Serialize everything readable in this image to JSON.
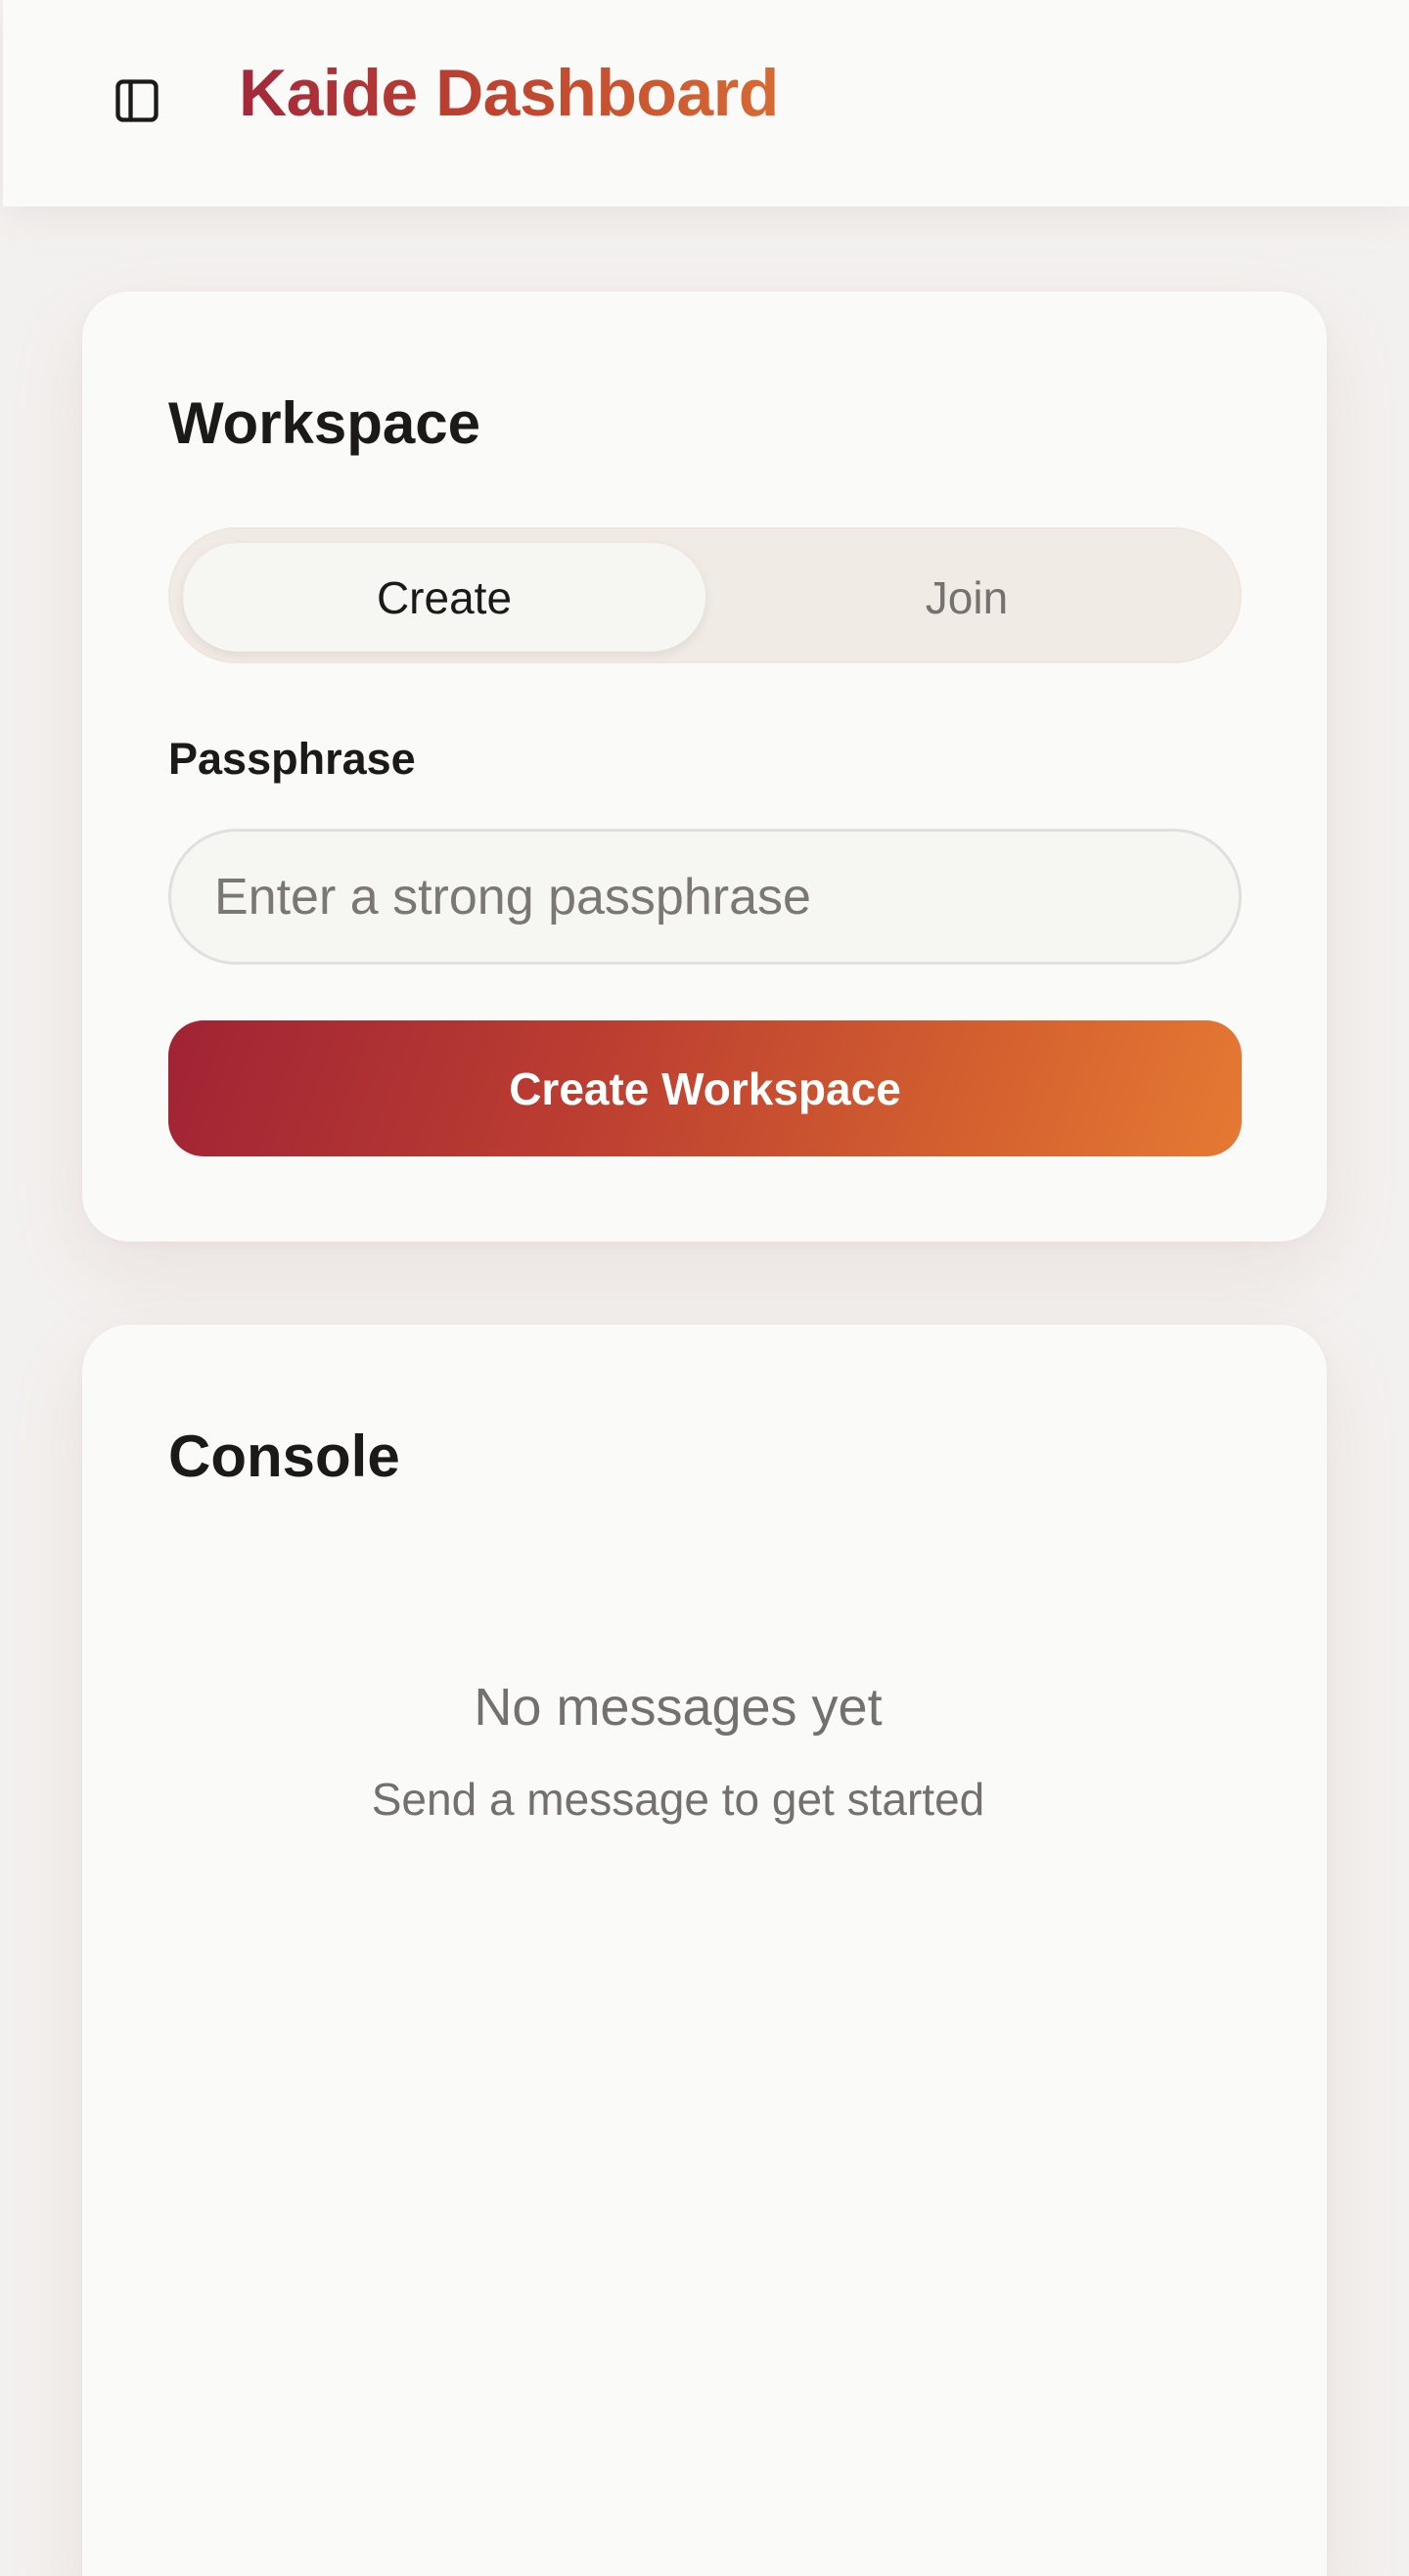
{
  "header": {
    "title": "Kaide Dashboard",
    "sidebar_toggle_icon": "sidebar-panel-icon"
  },
  "workspace": {
    "title": "Workspace",
    "tabs": [
      {
        "label": "Create",
        "selected": true
      },
      {
        "label": "Join",
        "selected": false
      }
    ],
    "passphrase_label": "Passphrase",
    "passphrase_value": "",
    "passphrase_placeholder": "Enter a strong passphrase",
    "submit_label": "Create Workspace"
  },
  "console": {
    "title": "Console",
    "empty_title": "No messages yet",
    "empty_subtitle": "Send a message to get started"
  },
  "colors": {
    "brand_start": "#a3283a",
    "brand_end": "#e57a33",
    "background": "#f3f1ef",
    "card": "#fafaf9"
  }
}
